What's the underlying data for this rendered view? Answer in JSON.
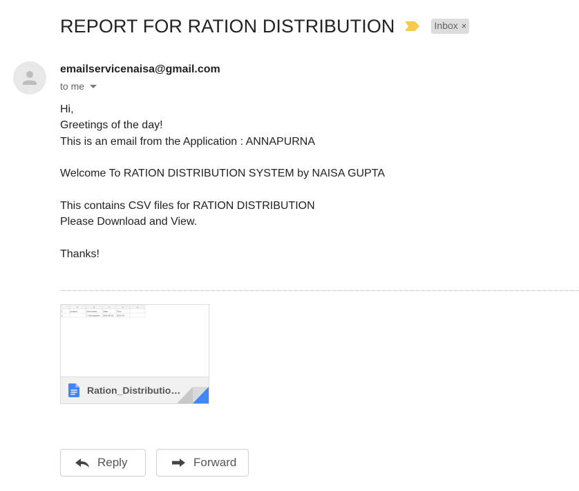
{
  "email": {
    "subject": "REPORT FOR RATION DISTRIBUTION",
    "label_chip": "Inbox",
    "label_chip_close": "×",
    "sender": "emailservicenaisa@gmail.com",
    "recipient": "to me",
    "body_lines": [
      "Hi,",
      "Greetings of the day!",
      "This is an email from the Application : ANNAPURNA",
      "",
      "Welcome To RATION DISTRIBUTION SYSTEM by NAISA GUPTA",
      "",
      "This contains CSV files for RATION DISTRIBUTION",
      "Please Download and View.",
      "",
      "Thanks!"
    ],
    "attachment": {
      "filename": "Ration_Distribution...",
      "icon": "google-docs-icon",
      "preview": {
        "columns": [
          "A",
          "B",
          "C",
          "D",
          "E"
        ],
        "rows": [
          [
            "1",
            "Location",
            "Usermaster",
            "State",
            "Time"
          ],
          [
            "2",
            "",
            "Y Sonbeganter",
            "2022-05-18",
            "2022-05"
          ]
        ]
      }
    },
    "actions": {
      "reply_label": "Reply",
      "forward_label": "Forward"
    }
  },
  "colors": {
    "importance_marker": "#f7cb4d",
    "chip_background": "#dddddd",
    "doc_icon": "#4285f4",
    "corner_fold": "#4285f4"
  }
}
